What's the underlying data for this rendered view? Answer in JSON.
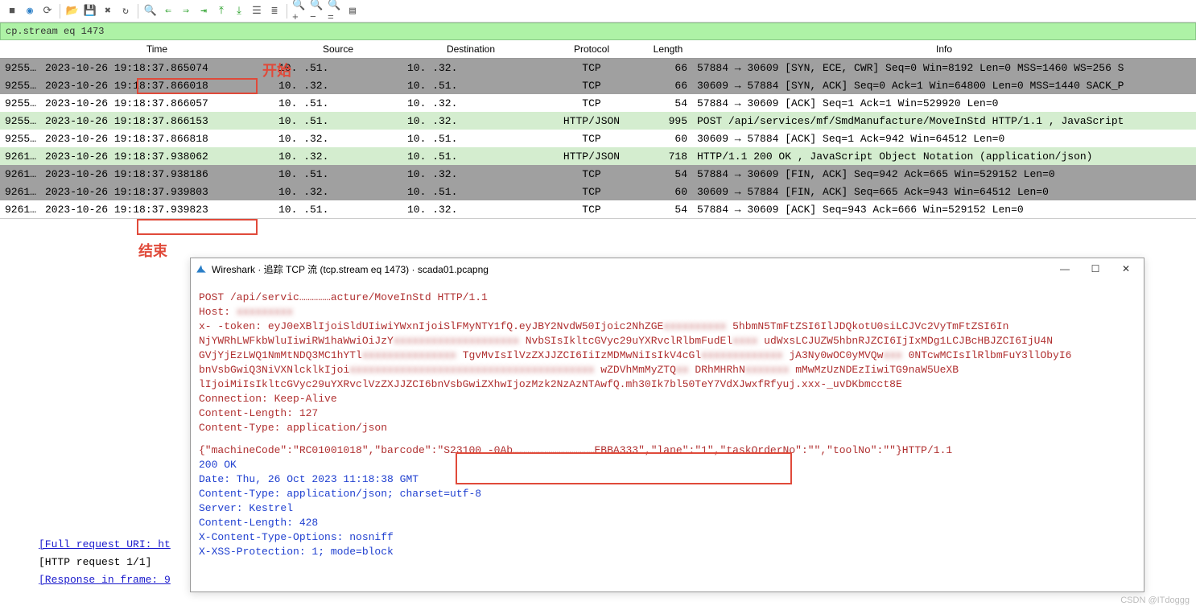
{
  "filter": "cp.stream eq 1473",
  "columns": {
    "time": "Time",
    "source": "Source",
    "destination": "Destination",
    "protocol": "Protocol",
    "length": "Length",
    "info": "Info"
  },
  "packets": [
    {
      "bg": "bg-darkg",
      "no": "9255…",
      "time": "2023-10-26 19:18:37.865074",
      "src": "10.  .51.",
      "dst": "10.  .32.",
      "proto": "TCP",
      "len": "66",
      "info": "57884 → 30609 [SYN, ECE, CWR] Seq=0 Win=8192 Len=0 MSS=1460 WS=256 S"
    },
    {
      "bg": "bg-darkg",
      "no": "9255…",
      "time": "2023-10-26 19:18:37.866018",
      "src": "10.  .32.",
      "dst": "10.  .51.",
      "proto": "TCP",
      "len": "66",
      "info": "30609 → 57884 [SYN, ACK] Seq=0 Ack=1 Win=64800 Len=0 MSS=1440 SACK_P"
    },
    {
      "bg": "bg-white",
      "no": "9255…",
      "time": "2023-10-26 19:18:37.866057",
      "src": "10.  .51.",
      "dst": "10.  .32.",
      "proto": "TCP",
      "len": "54",
      "info": "57884 → 30609 [ACK] Seq=1 Ack=1 Win=529920 Len=0"
    },
    {
      "bg": "bg-green",
      "no": "9255…",
      "time": "2023-10-26 19:18:37.866153",
      "src": "10.  .51.",
      "dst": "10.  .32.",
      "proto": "HTTP/JSON",
      "len": "995",
      "info": "POST /api/services/mf/SmdManufacture/MoveInStd HTTP/1.1 , JavaScript"
    },
    {
      "bg": "bg-white",
      "no": "9255…",
      "time": "2023-10-26 19:18:37.866818",
      "src": "10.  .32.",
      "dst": "10.  .51.",
      "proto": "TCP",
      "len": "60",
      "info": "30609 → 57884 [ACK] Seq=1 Ack=942 Win=64512 Len=0"
    },
    {
      "bg": "bg-green",
      "no": "9261…",
      "time": "2023-10-26 19:18:37.938062",
      "src": "10.  .32.",
      "dst": "10.  .51.",
      "proto": "HTTP/JSON",
      "len": "718",
      "info": "HTTP/1.1 200 OK , JavaScript Object Notation (application/json)"
    },
    {
      "bg": "bg-darkg",
      "no": "9261…",
      "time": "2023-10-26 19:18:37.938186",
      "src": "10.  .51.",
      "dst": "10.  .32.",
      "proto": "TCP",
      "len": "54",
      "info": "57884 → 30609 [FIN, ACK] Seq=942 Ack=665 Win=529152 Len=0"
    },
    {
      "bg": "bg-darkg",
      "no": "9261…",
      "time": "2023-10-26 19:18:37.939803",
      "src": "10.  .32.",
      "dst": "10.  .51.",
      "proto": "TCP",
      "len": "60",
      "info": "30609 → 57884 [FIN, ACK] Seq=665 Ack=943 Win=64512 Len=0"
    },
    {
      "bg": "bg-white",
      "no": "9261…",
      "time": "2023-10-26 19:18:37.939823",
      "src": "10.  .51.",
      "dst": "10.  .32.",
      "proto": "TCP",
      "len": "54",
      "info": "57884 → 30609 [ACK] Seq=943 Ack=666 Win=529152 Len=0"
    }
  ],
  "annotations": {
    "start": "开始",
    "end": "结束"
  },
  "follow_window": {
    "title": "Wireshark · 追踪 TCP 流 (tcp.stream eq 1473) · scada01.pcapng",
    "request": {
      "line1": "POST /api/servic……………acture/MoveInStd HTTP/1.1",
      "host": "Host: ",
      "token_l1a": "x-  -token: eyJ0eXBlIjoiSldUIiwiYWxnIjoiSlFMyNTY1fQ.eyJBY2NvdW50Ijoic2NhZGE",
      "token_l1b": "5hbmN5TmFtZSI6IlJDQkotU0siLCJVc2VyTmFtZSI6In",
      "token_l2a": "NjYWRhLWFkbWluIiwiRW1haWwiOiJzY",
      "token_l2b": "NvbSIsIkltcGVyc29uYXRvclRlbmFudEl",
      "token_l2c": "udWxsLCJUZW5hbnRJZCI6IjIxMDg1LCJBcHBJZCI6IjU4N",
      "token_l3a": "GVjYjEzLWQ1NmMtNDQ3MC1hYTl",
      "token_l3b": "TgvMvIsIlVzZXJJZCI6IiIzMDMwNiIsIkV4cGl",
      "token_l3c": "jA3Ny0wOC0yMVQw",
      "token_l3d": "0NTcwMCIsIlRlbmFuY3llObyI6",
      "token_l4a": "bnVsbGwiQ3NiVXNlcklkIjoi",
      "token_l4b": "wZDVhMmMyZTQ",
      "token_l4c": "DRhMHRhN",
      "token_l4d": "mMwMzUzNDEzIiwiTG9naW5UeXB",
      "token_l5": "lIjoiMiIsIkltcGVyc29uYXRvclVzZXJJZCI6bnVsbGwiZXhwIjozMzk2NzAzNTAwfQ.mh30Ik7bl50TeY7VdXJwxfRfyuj.xxx-_uvDKbmcct8E",
      "conn": "Connection: Keep-Alive",
      "clen": "Content-Length: 127",
      "ctype": "Content-Type: application/json",
      "body_a": "{\"machineCode\":\"RC01001018\",\"barcode\"",
      "body_b": ":\"S23100  -0Ab…………………………………EBBA333\"",
      "body_c": ",\"lane\":\"1\",\"taskOrderNo\":\"\",\"toolNo\":\"\"}HTTP/1.1"
    },
    "response": {
      "status": "200 OK",
      "date": "Date: Thu, 26 Oct 2023 11:18:38 GMT",
      "ctype": "Content-Type: application/json; charset=utf-8",
      "server": "Server: Kestrel",
      "clen": "Content-Length: 428",
      "xcto": "X-Content-Type-Options: nosniff",
      "xxss": "X-XSS-Protection: 1; mode=block"
    }
  },
  "bottom_links": {
    "l1": "[Full request URI: ht",
    "l2": "[HTTP request 1/1]",
    "l3": "[Response in frame: 9"
  },
  "watermark": "CSDN @ITdoggg"
}
